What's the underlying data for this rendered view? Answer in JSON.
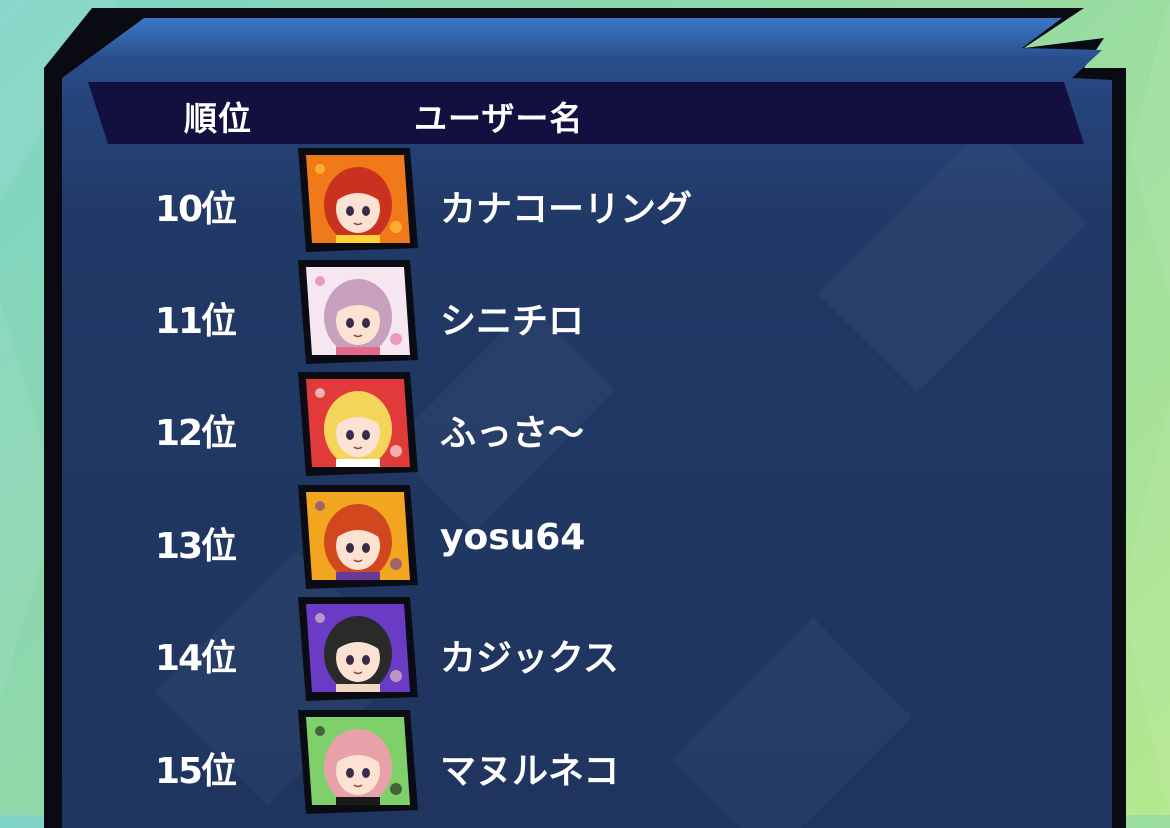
{
  "header": {
    "rank_label": "順位",
    "user_label": "ユーザー名"
  },
  "rows": [
    {
      "rank": "10位",
      "name": "カナコーリング",
      "avatar": "avatar-kanakoring",
      "colors": {
        "bg": "#f07a1a",
        "hair": "#c8321e",
        "accent": "#ffd23a"
      }
    },
    {
      "rank": "11位",
      "name": "シニチロ",
      "avatar": "avatar-shinichiro",
      "colors": {
        "bg": "#f6e6f0",
        "hair": "#c7a0bd",
        "accent": "#e46a8c"
      }
    },
    {
      "rank": "12位",
      "name": "ふっさ～",
      "avatar": "avatar-fussa",
      "colors": {
        "bg": "#e03a3a",
        "hair": "#f5d45a",
        "accent": "#ffffff"
      }
    },
    {
      "rank": "13位",
      "name": "yosu64",
      "avatar": "avatar-yosu64",
      "colors": {
        "bg": "#f2a51e",
        "hair": "#d2481e",
        "accent": "#6a3a9a"
      }
    },
    {
      "rank": "14位",
      "name": "カジックス",
      "avatar": "avatar-kajikkusu",
      "colors": {
        "bg": "#6a3bc4",
        "hair": "#2a2a2a",
        "accent": "#f2d7c2"
      }
    },
    {
      "rank": "15位",
      "name": "マヌルネコ",
      "avatar": "avatar-manulneko",
      "colors": {
        "bg": "#7fd06a",
        "hair": "#e9a0a8",
        "accent": "#1a1a1a"
      }
    }
  ]
}
